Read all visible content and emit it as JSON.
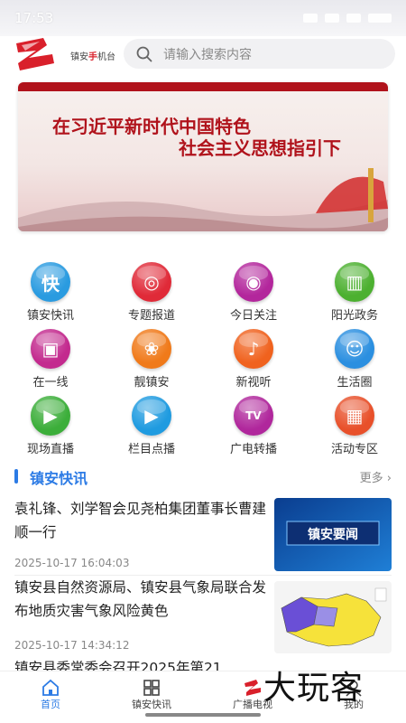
{
  "status": {
    "time": "17:53"
  },
  "header": {
    "brand_prefix": "镇安",
    "brand_highlight": "手",
    "brand_suffix": "机台",
    "search_placeholder": "请输入搜索内容"
  },
  "banner": {
    "line1": "在习近平新时代中国特色",
    "line2": "社会主义思想指引下"
  },
  "grid": [
    {
      "label": "镇安快讯",
      "icon": "kuai-icon",
      "color": "#2a9be0",
      "glyph": "快"
    },
    {
      "label": "专题报道",
      "icon": "target-icon",
      "color": "#e02a38",
      "glyph": "◎"
    },
    {
      "label": "今日关注",
      "icon": "eye-icon",
      "color": "#b3269c",
      "glyph": "◉"
    },
    {
      "label": "阳光政务",
      "icon": "book-icon",
      "color": "#4cb030",
      "glyph": "▥"
    },
    {
      "label": "在一线",
      "icon": "camera-icon",
      "color": "#c32a8e",
      "glyph": "▣"
    },
    {
      "label": "靓镇安",
      "icon": "tulip-icon",
      "color": "#f07a1a",
      "glyph": "❀"
    },
    {
      "label": "新视听",
      "icon": "microphone-icon",
      "color": "#f0621e",
      "glyph": "♪"
    },
    {
      "label": "生活圈",
      "icon": "smile-cloud-icon",
      "color": "#2b8fe0",
      "glyph": "☺"
    },
    {
      "label": "现场直播",
      "icon": "video-camera-icon",
      "color": "#3cae3a",
      "glyph": "▶"
    },
    {
      "label": "栏目点播",
      "icon": "play-icon",
      "color": "#1f9be0",
      "glyph": "▶"
    },
    {
      "label": "广电转播",
      "icon": "tv-icon",
      "color": "#b0279c",
      "glyph": "TV"
    },
    {
      "label": "活动专区",
      "icon": "gift-icon",
      "color": "#e8502a",
      "glyph": "▦"
    }
  ],
  "section": {
    "title": "镇安快讯",
    "more": "更多"
  },
  "news": [
    {
      "title": "袁礼锋、刘学智会见尧柏集团董事长曹建顺一行",
      "time": "2025-10-17 16:04:03",
      "thumb_text": "镇安要闻"
    },
    {
      "title": "镇安县自然资源局、镇安县气象局联合发布地质灾害气象风险黄色",
      "time": "2025-10-17 14:34:12",
      "thumb_text": ""
    },
    {
      "title": "镇安县委常委会召开2025年第21",
      "time": "",
      "thumb_text": ""
    }
  ],
  "tabs": [
    {
      "label": "首页",
      "icon": "home-icon",
      "active": true
    },
    {
      "label": "镇安快讯",
      "icon": "grid-icon",
      "active": false
    },
    {
      "label": "广播电视",
      "icon": "logo-tab-icon",
      "active": false
    },
    {
      "label": "我的",
      "icon": "user-icon",
      "active": false
    }
  ],
  "watermark": "大玩客",
  "colors": {
    "accent": "#2c7be5",
    "brand_red": "#d9202b"
  }
}
